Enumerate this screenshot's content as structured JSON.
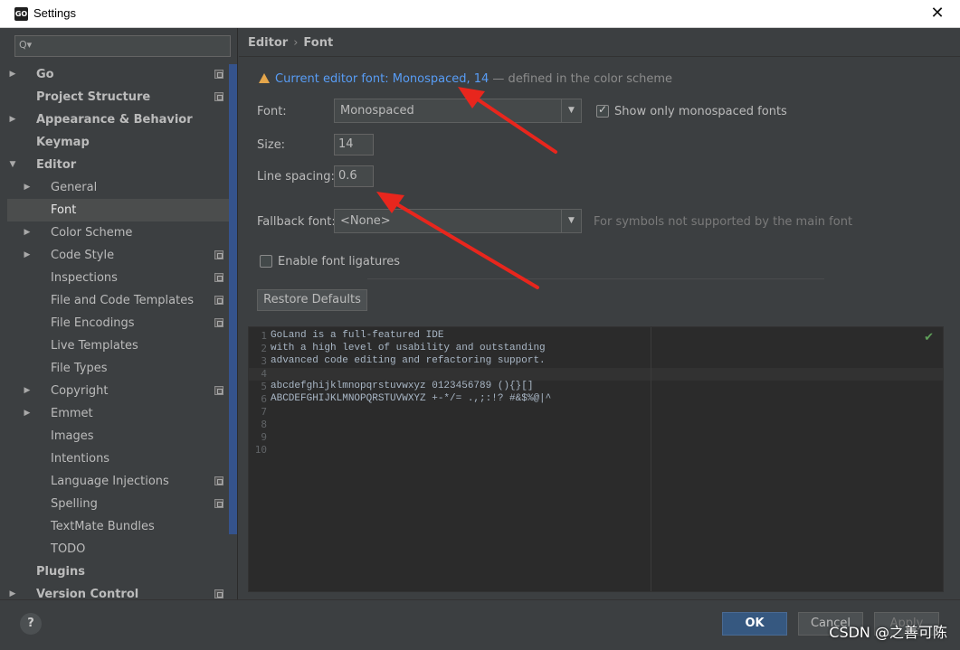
{
  "window": {
    "title": "Settings",
    "app_icon": "GO"
  },
  "sidebar": {
    "search_placeholder": "Q▾",
    "items": [
      {
        "label": "Go",
        "bold": true,
        "arrow": "▶",
        "indent": 0,
        "page": true
      },
      {
        "label": "Project Structure",
        "bold": true,
        "arrow": "",
        "indent": 0,
        "page": true
      },
      {
        "label": "Appearance & Behavior",
        "bold": true,
        "arrow": "▶",
        "indent": 0,
        "page": false
      },
      {
        "label": "Keymap",
        "bold": true,
        "arrow": "",
        "indent": 0,
        "page": false
      },
      {
        "label": "Editor",
        "bold": true,
        "arrow": "▼",
        "indent": 0,
        "page": false
      },
      {
        "label": "General",
        "bold": false,
        "arrow": "▶",
        "indent": 1,
        "page": false
      },
      {
        "label": "Font",
        "bold": false,
        "arrow": "",
        "indent": 1,
        "page": false,
        "selected": true
      },
      {
        "label": "Color Scheme",
        "bold": false,
        "arrow": "▶",
        "indent": 1,
        "page": false
      },
      {
        "label": "Code Style",
        "bold": false,
        "arrow": "▶",
        "indent": 1,
        "page": true
      },
      {
        "label": "Inspections",
        "bold": false,
        "arrow": "",
        "indent": 1,
        "page": true
      },
      {
        "label": "File and Code Templates",
        "bold": false,
        "arrow": "",
        "indent": 1,
        "page": true
      },
      {
        "label": "File Encodings",
        "bold": false,
        "arrow": "",
        "indent": 1,
        "page": true
      },
      {
        "label": "Live Templates",
        "bold": false,
        "arrow": "",
        "indent": 1,
        "page": false
      },
      {
        "label": "File Types",
        "bold": false,
        "arrow": "",
        "indent": 1,
        "page": false
      },
      {
        "label": "Copyright",
        "bold": false,
        "arrow": "▶",
        "indent": 1,
        "page": true
      },
      {
        "label": "Emmet",
        "bold": false,
        "arrow": "▶",
        "indent": 1,
        "page": false
      },
      {
        "label": "Images",
        "bold": false,
        "arrow": "",
        "indent": 1,
        "page": false
      },
      {
        "label": "Intentions",
        "bold": false,
        "arrow": "",
        "indent": 1,
        "page": false
      },
      {
        "label": "Language Injections",
        "bold": false,
        "arrow": "",
        "indent": 1,
        "page": true
      },
      {
        "label": "Spelling",
        "bold": false,
        "arrow": "",
        "indent": 1,
        "page": true
      },
      {
        "label": "TextMate Bundles",
        "bold": false,
        "arrow": "",
        "indent": 1,
        "page": false
      },
      {
        "label": "TODO",
        "bold": false,
        "arrow": "",
        "indent": 1,
        "page": false
      },
      {
        "label": "Plugins",
        "bold": true,
        "arrow": "",
        "indent": 0,
        "page": false
      },
      {
        "label": "Version Control",
        "bold": true,
        "arrow": "▶",
        "indent": 0,
        "page": true
      }
    ]
  },
  "breadcrumb": {
    "part1": "Editor",
    "sep": "›",
    "part2": "Font"
  },
  "warning": {
    "link": "Current editor font: Monospaced, 14",
    "rest": " — defined in the color scheme"
  },
  "form": {
    "font_label": "Font:",
    "font_value": "Monospaced",
    "show_mono_label": "Show only monospaced fonts",
    "show_mono_checked": true,
    "size_label": "Size:",
    "size_value": "14",
    "line_spacing_label": "Line spacing:",
    "line_spacing_value": "0.6",
    "fallback_label": "Fallback font:",
    "fallback_value": "<None>",
    "fallback_hint": "For symbols not supported by the main font",
    "ligatures_label": "Enable font ligatures",
    "ligatures_checked": false,
    "restore_label": "Restore Defaults"
  },
  "preview": {
    "line_numbers": [
      "1",
      "2",
      "3",
      "4",
      "5",
      "6",
      "7",
      "8",
      "9",
      "10"
    ],
    "lines": [
      "GoLand is a full-featured IDE",
      "with a high level of usability and outstanding",
      "advanced code editing and refactoring support.",
      "",
      "abcdefghijklmnopqrstuvwxyz 0123456789 (){}[]",
      "ABCDEFGHIJKLMNOPQRSTUVWXYZ +-*/= .,;:!? #&$%@|^",
      "",
      "",
      "",
      ""
    ]
  },
  "footer": {
    "help": "?",
    "ok": "OK",
    "cancel": "Cancel",
    "apply": "Apply"
  },
  "watermark": "CSDN @之善可陈",
  "colors": {
    "accent_link": "#589df6",
    "warning": "#e5a64b",
    "arrow": "#e8261d",
    "ok_button": "#365880"
  }
}
